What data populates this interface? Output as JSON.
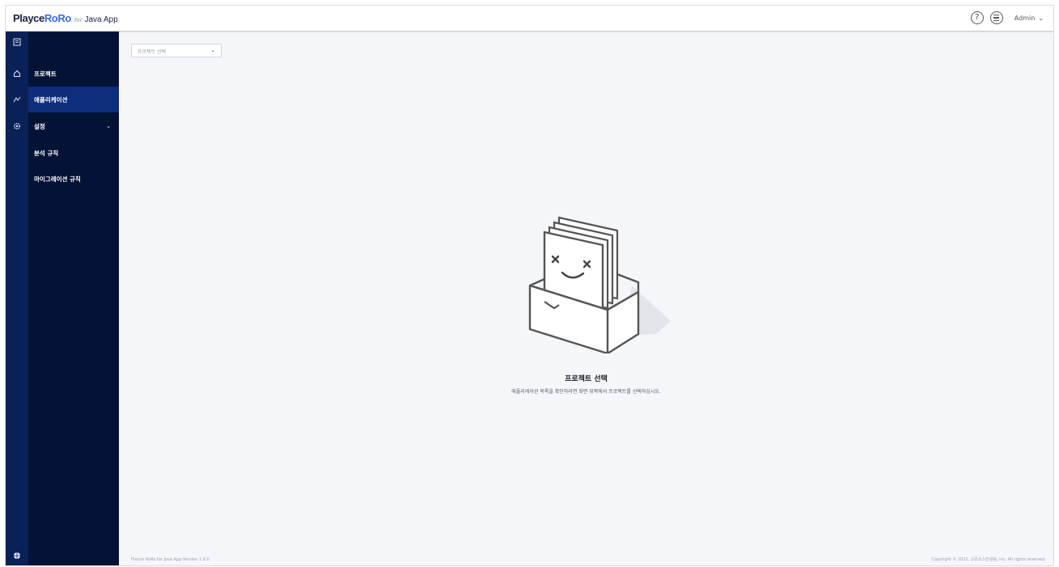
{
  "header": {
    "logo_main_a": "Playce",
    "logo_main_b": "RoRo",
    "logo_for": "for",
    "logo_app": "Java App",
    "help_icon": "question-circle-icon",
    "menu_icon": "list-circle-icon",
    "user_label": "Admin",
    "user_chevron": "⌄"
  },
  "rail": {
    "toggle_icon": "menu-toggle-icon",
    "home_icon": "home-icon",
    "app_icon": "application-icon",
    "settings_icon": "gear-icon",
    "bottom_icon": "globe-icon"
  },
  "sidebar": {
    "items": [
      {
        "label": "프로젝트"
      },
      {
        "label": "애플리케이션"
      },
      {
        "label": "설정"
      },
      {
        "label": "분석 규칙"
      },
      {
        "label": "마이그레이션 규칙"
      }
    ],
    "settings_chevron": "⌄"
  },
  "main": {
    "project_select": {
      "placeholder": "프로젝트 선택",
      "chevron": "⌄"
    },
    "empty": {
      "title": "프로젝트 선택",
      "description": "애플리케이션 목록을 확인하려면 화면 위쪽에서 프로젝트를 선택하십시오."
    }
  },
  "footer": {
    "version": "Playce RoRo for Java App Version 1.0.0",
    "copyright": "Copyright © 2022, 오픈소스컨설팅, Inc. All rights reserved."
  },
  "colors": {
    "rail": "#0a2158",
    "sidebar": "#031235",
    "active_item": "#0d2d7d",
    "background": "#f5f6fa",
    "accent": "#3a68d8"
  }
}
